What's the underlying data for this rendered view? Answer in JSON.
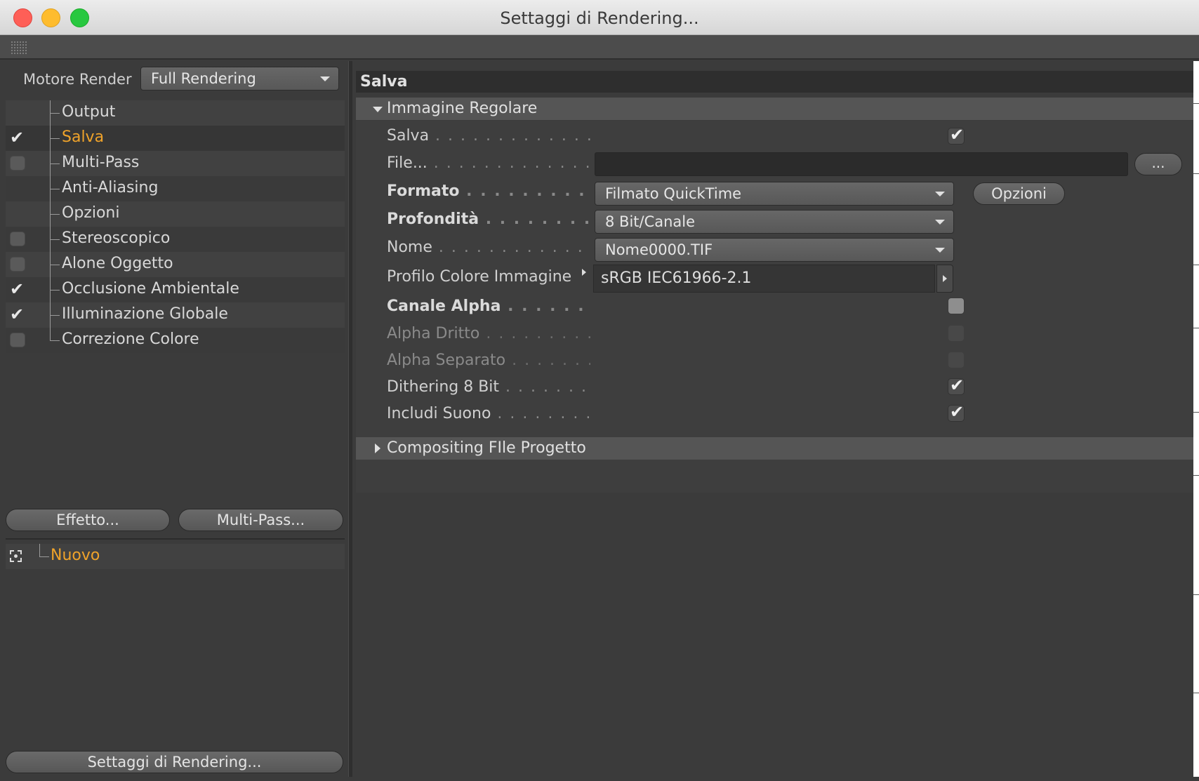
{
  "window": {
    "title": "Settaggi di Rendering..."
  },
  "left": {
    "engine_label": "Motore Render",
    "engine_value": "Full Rendering",
    "tree": [
      {
        "label": "Output",
        "checkbox": "none",
        "active": false
      },
      {
        "label": "Salva",
        "checkbox": "checked",
        "active": true
      },
      {
        "label": "Multi-Pass",
        "checkbox": "unchecked",
        "active": false
      },
      {
        "label": "Anti-Aliasing",
        "checkbox": "none",
        "active": false
      },
      {
        "label": "Opzioni",
        "checkbox": "none",
        "active": false
      },
      {
        "label": "Stereoscopico",
        "checkbox": "unchecked",
        "active": false
      },
      {
        "label": "Alone Oggetto",
        "checkbox": "unchecked",
        "active": false
      },
      {
        "label": "Occlusione Ambientale",
        "checkbox": "checked",
        "active": false
      },
      {
        "label": "Illuminazione Globale",
        "checkbox": "checked",
        "active": false
      },
      {
        "label": "Correzione Colore",
        "checkbox": "unchecked",
        "active": false
      }
    ],
    "effect_button": "Effetto...",
    "multipass_button": "Multi-Pass...",
    "settings_item": "Nuovo",
    "render_settings_button": "Settaggi di Rendering..."
  },
  "right": {
    "section_title": "Salva",
    "group1_title": "Immagine Regolare",
    "group2_title": "Compositing FIle Progetto",
    "props": {
      "salva": {
        "label": "Salva",
        "checked": true
      },
      "file": {
        "label": "File...",
        "value": "",
        "browse": "..."
      },
      "formato": {
        "label": "Formato",
        "value": "Filmato QuickTime",
        "options_button": "Opzioni"
      },
      "profondita": {
        "label": "Profondità",
        "value": "8 Bit/Canale"
      },
      "nome": {
        "label": "Nome",
        "value": "Nome0000.TIF"
      },
      "profilo": {
        "label": "Profilo Colore Immagine",
        "value": "sRGB IEC61966-2.1"
      },
      "canale_alpha": {
        "label": "Canale Alpha",
        "checked": false
      },
      "alpha_dritto": {
        "label": "Alpha Dritto",
        "checked": false
      },
      "alpha_separato": {
        "label": "Alpha Separato",
        "checked": false
      },
      "dithering": {
        "label": "Dithering 8 Bit",
        "checked": true
      },
      "suono": {
        "label": "Includi Suono",
        "checked": true
      }
    }
  }
}
